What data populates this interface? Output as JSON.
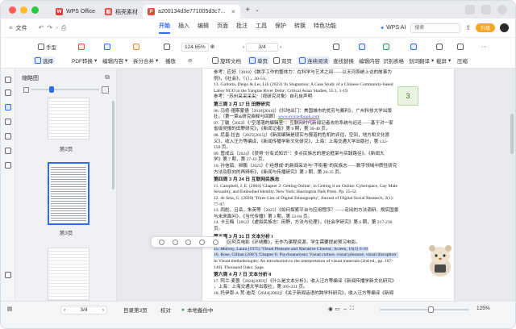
{
  "tabs": [
    {
      "label": "WPS Office",
      "icon": "wps-logo-icon",
      "color": "#e23b3b"
    },
    {
      "label": "稻壳素材",
      "icon": "docer-icon",
      "color": "#e8453c"
    },
    {
      "label": "a200134d3e771005d3c7...",
      "icon": "pdf-icon",
      "color": "#e24a3b",
      "active": true
    }
  ],
  "menubar": {
    "file": "文件",
    "items": [
      "开始",
      "插入",
      "编辑",
      "页面",
      "批注",
      "工具",
      "保护",
      "转换",
      "特色功能"
    ],
    "selected": "开始",
    "search_placeholder": "搜索",
    "ai_label": "WPS AI",
    "upgrade": "升级"
  },
  "toolbar": {
    "hand": "手型",
    "select": "选择",
    "pdf_convert": "PDF转换",
    "edit_content": "编辑内容",
    "split_merge": "拆分合并",
    "play": "播放",
    "zoom": "124.65%",
    "page_indicator": "3/4",
    "single_page": "单页",
    "double_page": "双页",
    "continuous": "连续阅读",
    "rotate": "旋转文档",
    "find_replace": "查找替换",
    "edit_page": "编辑内容",
    "ocr": "识别表格",
    "translate": "划词翻译",
    "screenshot": "截屏",
    "compress": "压缩",
    "insert": "插入页面",
    "extract": "提取"
  },
  "thumbnails": {
    "title": "缩略图",
    "pages": [
      {
        "label": "第2页"
      },
      {
        "label": "第3页",
        "selected": true
      },
      {
        "label": "第4页"
      }
    ]
  },
  "document": {
    "lines": [
      "参考：应好（2018）《数字工作的整体力：在科学与艺术之间——以天河系统上访的故事为",
      "例》，《社会》，（1），30-53。",
      "13. Gullotta, Diego & Lei, Lili (2023) 'In Stagnation: A Case Study of a Chinese Community-based",
      "Labor NGO in the Yangtze River Delta', Critical Asian Studies, 55:1, 1-19.",
      "参考：\"苏州采采采采\"（视研究对象）自孔自声明",
      "第三周 3 月 17 日 田野研究",
      "06. 马修·德斯蒙德（2018[2016]）《扫地出门：美国城市的贫穷与暴利》，广州科技大学出版",
      "社。（第一章&研究阐释与回顾）www.evictedbook.com",
      "07. 丁敏（2022）《\"空落落的编辑室\"：互联网时代新闻记者去的系统与迟迟——基于对一家",
      "省级党报的田野研究》，《新闻记者》第 6 期，第 30-40 页。",
      "08. 尼基·拉吉（2025[2015]）《新闻编辑是现实与报道的危机的评估，空间，地方和文化意",
      "义》，收入汪方等编译，《新闻传播学新文化研究》，上海：上海交通大学出版社，第 132-",
      "150 页。",
      "09. 管成云（2024）《获得\"分有式知识\"：多点民族志的理论框架与实践路径》，《新闻大",
      "学》第 7 期，第 27-41 页。",
      "10. 孙信茹、卵鹏（2025）《\"经想成\"的新闻采访与\"不衔着\"的民族志——数字领域中质性研究",
      "方法及取向的再辨析》，《新闻与传播研究》第 2 期，第 20-35 页。",
      "第四周 3 月 24 日 互联网民族志",
      "11. Campbell, J. E. (2004) 'Chapter 2: Getting Online', in Getting it on Online: Cyberspace, Gay Male",
      "Sexuality, and Embodied Identity. New York: Harrington Park Press. Pp. 25-52.",
      "12. de Seta, G. (2020) 'Three Lies of Digital Ethnography', Journal of Digital Social Research, 2(1):",
      "77-97.",
      "13. 阎彪，吕岳，朱英等（2025）《如何探索平台与应用程序？——走出的方法调研、规实国景",
      "与未来面问》，《当代传播》第 3 期，第 53-64 页。",
      "14. 卡玉梅（2012）《虚拟民族志：田野，方法与伦理》，《社会学研究》第 6 期，第 217-236",
      "页。",
      "第五周 3 月 31 日 文本分析 I",
      "讨论者区阿克电影《环绕舞》，无作为课程资源，学生需要提前预习电影。",
      "15. Mulvey, Laura (1975) 'Visual Pleasure and Narrative Cinema', Screen, 16(3) 6-18.",
      "16. Rose, Gillian (2007) 'Chapter 6: Psychoanalysis: Visual culture, visual pleasure, visual disruption'.",
      "In Visual methodologies: An introduction to the interpretation of visual materials (2nd ed., pp. 107-",
      "140). Thousand Oaks: Sage.",
      "第六周 4 月 7 日 文本分析 II",
      "17. 阿兰·麦蓉（2024[2003]）《什么是文本分析》，收入汪方等编译《新闻传播学新文化研究》",
      "，上海：上海交通大学出版社，第 305-331 页。",
      "18. 托伊恩·A·梵·迪克（2024[2002]）《关于新闻话语的跨学科研究》，收入汪方等编译《新闻"
    ],
    "url_text": "www.evictedbook.com",
    "page_marker": "3"
  },
  "statusbar": {
    "page_value": "3/4",
    "annotations": "目录第3页",
    "proofread": "校对",
    "save_status": "本地备份中",
    "zoom": "125%"
  }
}
